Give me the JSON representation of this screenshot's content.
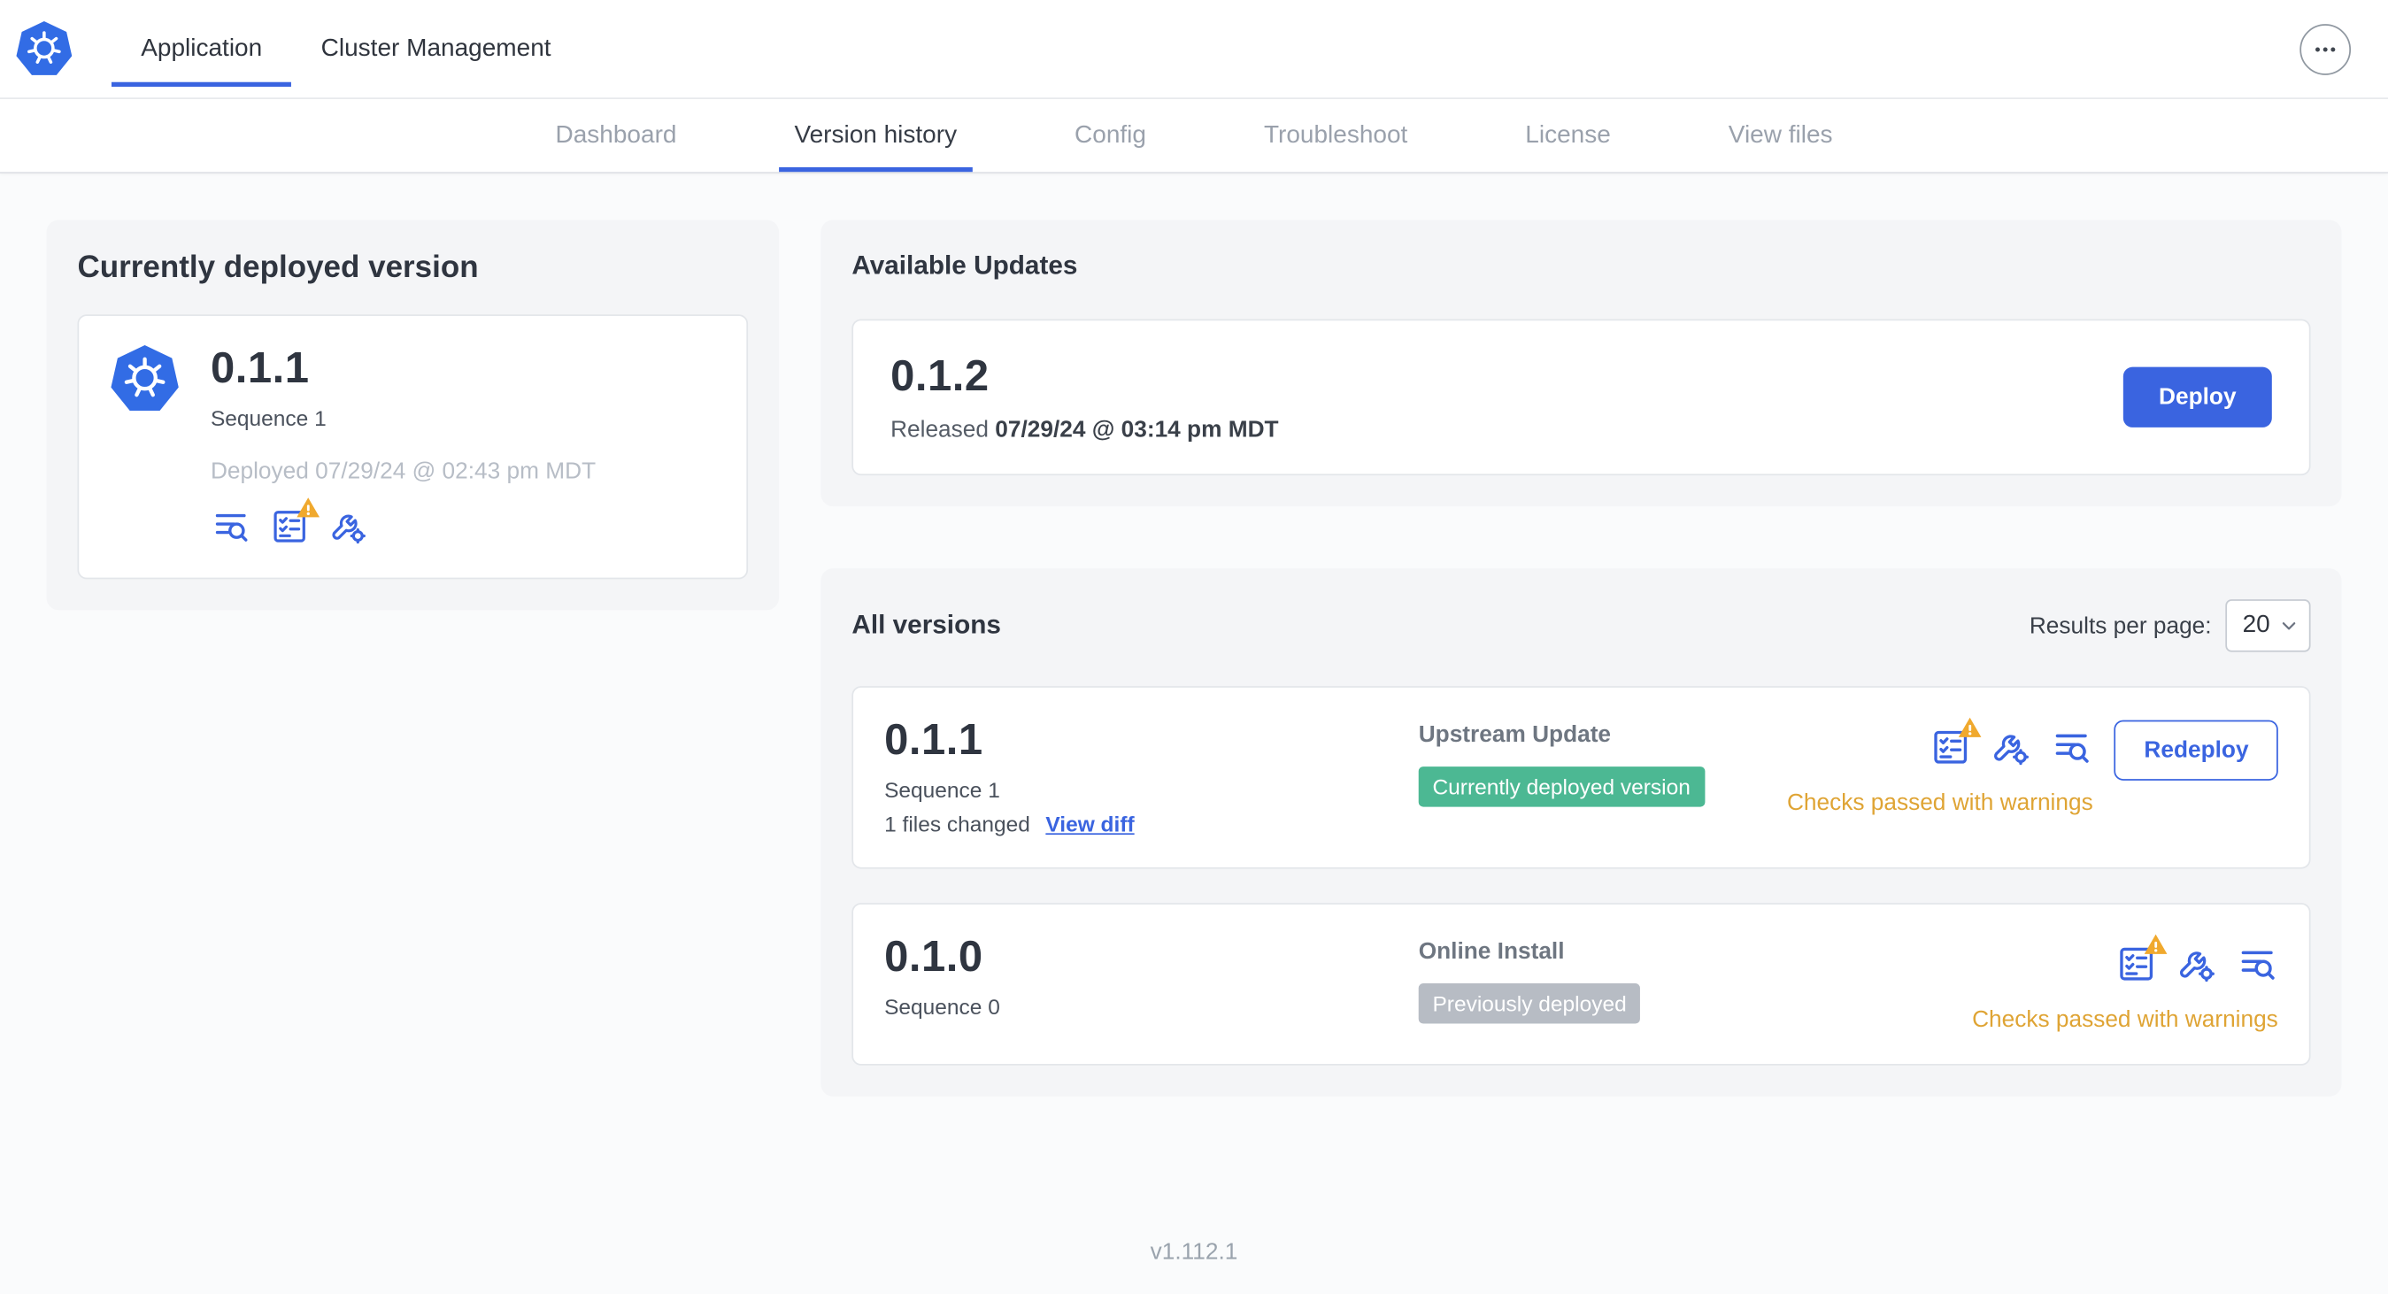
{
  "header": {
    "tabs": [
      {
        "label": "Application",
        "active": true
      },
      {
        "label": "Cluster Management",
        "active": false
      }
    ]
  },
  "nav": {
    "items": [
      {
        "label": "Dashboard",
        "active": false
      },
      {
        "label": "Version history",
        "active": true
      },
      {
        "label": "Config",
        "active": false
      },
      {
        "label": "Troubleshoot",
        "active": false
      },
      {
        "label": "License",
        "active": false
      },
      {
        "label": "View files",
        "active": false
      }
    ]
  },
  "current_version": {
    "title": "Currently deployed version",
    "version": "0.1.1",
    "sequence": "Sequence 1",
    "deployed": "Deployed 07/29/24 @ 02:43 pm MDT"
  },
  "available_updates": {
    "title": "Available Updates",
    "version": "0.1.2",
    "released_prefix": "Released",
    "released_date": "07/29/24 @ 03:14 pm MDT",
    "deploy_label": "Deploy"
  },
  "all_versions": {
    "title": "All versions",
    "results_per_page_label": "Results per page:",
    "results_per_page_value": "20",
    "rows": [
      {
        "version": "0.1.1",
        "sequence": "Sequence 1",
        "files_changed": "1 files changed",
        "view_diff": "View diff",
        "source": "Upstream Update",
        "badge": "Currently deployed version",
        "badge_color": "#4cb893",
        "checks": "Checks passed with warnings",
        "action": "Redeploy"
      },
      {
        "version": "0.1.0",
        "sequence": "Sequence 0",
        "source": "Online Install",
        "badge": "Previously deployed",
        "badge_color": "#b7bcc4",
        "checks": "Checks passed with warnings"
      }
    ]
  },
  "footer": {
    "version": "v1.112.1"
  },
  "icons": {
    "logo": "kubernetes-logo",
    "more": "ellipsis-icon",
    "release_notes": "release-notes-icon",
    "preflight": "preflight-checklist-icon",
    "preflight_warning": "warning-triangle-icon",
    "config": "wrench-gear-icon",
    "select_chevron": "chevron-down-icon"
  },
  "colors": {
    "accent": "#3a64e0",
    "warning_text": "#dfa434",
    "warning_triangle": "#f0a92e",
    "green_badge": "#4cb893",
    "gray_badge": "#b7bcc4"
  }
}
